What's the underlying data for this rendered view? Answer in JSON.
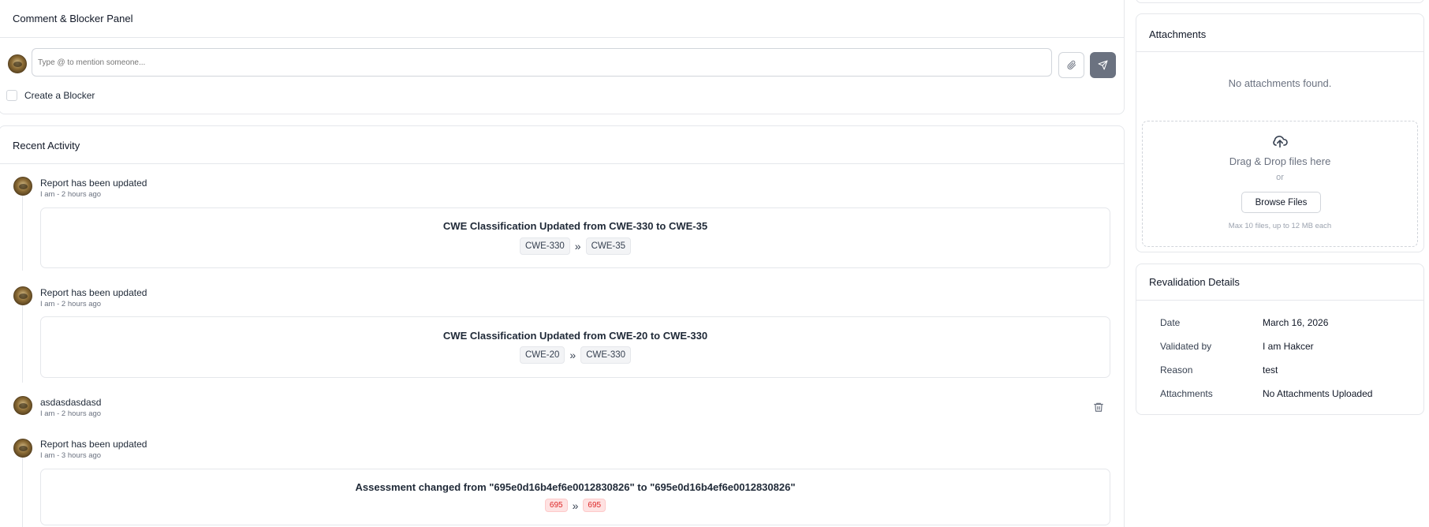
{
  "comment_panel": {
    "title": "Comment & Blocker Panel",
    "input_placeholder": "Type @ to mention someone...",
    "blocker_label": "Create a Blocker"
  },
  "activity": {
    "title": "Recent Activity",
    "items": [
      {
        "title": "Report has been updated",
        "meta": "I am - 2 hours ago",
        "change_heading": "CWE Classification Updated from CWE-330 to CWE-35",
        "from": "CWE-330",
        "to": "CWE-35"
      },
      {
        "title": "Report has been updated",
        "meta": "I am - 2 hours ago",
        "change_heading": "CWE Classification Updated from CWE-20 to CWE-330",
        "from": "CWE-20",
        "to": "CWE-330"
      },
      {
        "title": "asdasdasdasd",
        "meta": "I am - 2 hours ago"
      },
      {
        "title": "Report has been updated",
        "meta": "I am - 3 hours ago",
        "change_heading": "Assessment changed from \"695e0d16b4ef6e0012830826\" to \"695e0d16b4ef6e0012830826\"",
        "from": "695",
        "to": "695"
      }
    ],
    "arrow": "»"
  },
  "attachments": {
    "title": "Attachments",
    "empty_text": "No attachments found.",
    "drop_text": "Drag & Drop files here",
    "or_text": "or",
    "browse_label": "Browse Files",
    "limit_text": "Max 10 files, up to 12 MB each"
  },
  "revalidation": {
    "title": "Revalidation Details",
    "rows": [
      {
        "label": "Date",
        "value": "March 16, 2026"
      },
      {
        "label": "Validated by",
        "value": "I am Hakcer"
      },
      {
        "label": "Reason",
        "value": "test"
      },
      {
        "label": "Attachments",
        "value": "No Attachments Uploaded"
      }
    ]
  }
}
